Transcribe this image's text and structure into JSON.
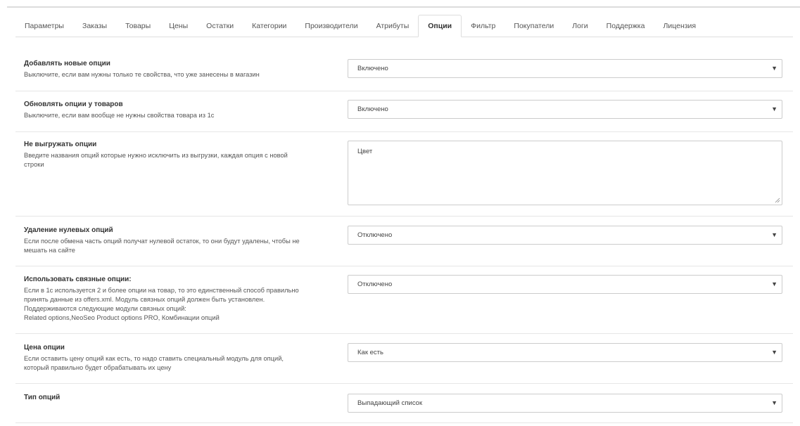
{
  "tabs": [
    {
      "label": "Параметры"
    },
    {
      "label": "Заказы"
    },
    {
      "label": "Товары"
    },
    {
      "label": "Цены"
    },
    {
      "label": "Остатки"
    },
    {
      "label": "Категории"
    },
    {
      "label": "Производители"
    },
    {
      "label": "Атрибуты"
    },
    {
      "label": "Опции",
      "active": true
    },
    {
      "label": "Фильтр"
    },
    {
      "label": "Покупатели"
    },
    {
      "label": "Логи"
    },
    {
      "label": "Поддержка"
    },
    {
      "label": "Лицензия"
    }
  ],
  "settings": {
    "add_new": {
      "title": "Добавлять новые опции",
      "desc": "Выключите, если вам нужны только те свойства, что уже занесены в магазин",
      "value": "Включено"
    },
    "update": {
      "title": "Обновлять опции у товаров",
      "desc": "Выключите, если вам вообще не нужны свойства товара из 1с",
      "value": "Включено"
    },
    "exclude": {
      "title": "Не выгружать опции",
      "desc": "Введите названия опций которые нужно исключить из выгрузки, каждая опция с новой\nстроки",
      "value": "Цвет"
    },
    "zero_remove": {
      "title": "Удаление нулевых опций",
      "desc": "Если после обмена часть опций получат нулевой остаток, то они будут удалены, чтобы не\nмешать на сайте",
      "value": "Отключено"
    },
    "related": {
      "title": "Использовать связные опции:",
      "desc": "Если в 1с используется 2 и более опции на товар, то это единственный способ правильно\nпринять данные из offers.xml. Модуль связных опций должен быть установлен.\nПоддерживаются следующие модули связных опций:\nRelated options,NeoSeo Product options PRO, Комбинации опций",
      "value": "Отключено"
    },
    "price": {
      "title": "Цена опции",
      "desc": "Если оставить цену опций как есть, то надо ставить специальный модуль для опций,\nкоторый правильно будет обрабатывать их цену",
      "value": "Как есть"
    },
    "type": {
      "title": "Тип опций",
      "desc": "",
      "value": "Выпадающий список"
    }
  },
  "icons": {
    "dropdown": "triangle-down",
    "resize": "resize-grip"
  }
}
